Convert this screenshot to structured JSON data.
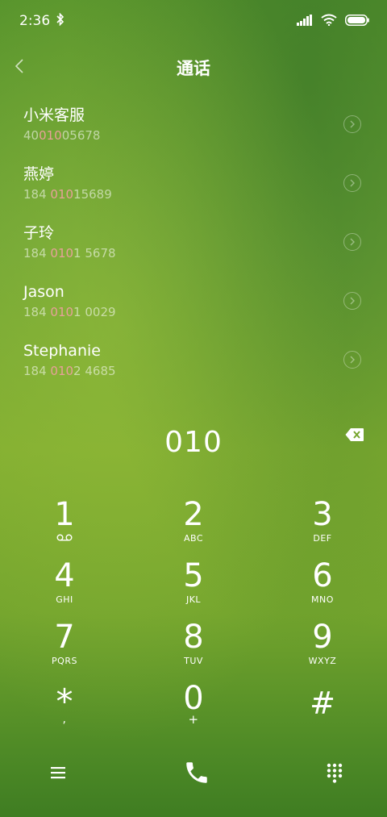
{
  "status": {
    "time": "2:36"
  },
  "header": {
    "title": "通话"
  },
  "contacts": [
    {
      "name": "小米客服",
      "number_pre": "40",
      "number_hl": "010",
      "number_post": "05678"
    },
    {
      "name": "燕婷",
      "number_pre": "184 ",
      "number_hl": "010",
      "number_post": "15689"
    },
    {
      "name": "子玲",
      "number_pre": "184 ",
      "number_hl": "010",
      "number_post": "1 5678"
    },
    {
      "name": "Jason",
      "number_pre": "184 ",
      "number_hl": "010",
      "number_post": "1 0029"
    },
    {
      "name": "Stephanie",
      "number_pre": "184 ",
      "number_hl": "010",
      "number_post": "2 4685"
    }
  ],
  "dialer": {
    "input": "010",
    "keys": [
      {
        "digit": "1",
        "letters": ""
      },
      {
        "digit": "2",
        "letters": "ABC"
      },
      {
        "digit": "3",
        "letters": "DEF"
      },
      {
        "digit": "4",
        "letters": "GHI"
      },
      {
        "digit": "5",
        "letters": "JKL"
      },
      {
        "digit": "6",
        "letters": "MNO"
      },
      {
        "digit": "7",
        "letters": "PQRS"
      },
      {
        "digit": "8",
        "letters": "TUV"
      },
      {
        "digit": "9",
        "letters": "WXYZ"
      },
      {
        "digit": "*",
        "letters": ","
      },
      {
        "digit": "0",
        "letters": "+"
      },
      {
        "digit": "#",
        "letters": ""
      }
    ]
  },
  "icons": {
    "bluetooth": "bluetooth-icon",
    "signal": "signal-icon",
    "wifi": "wifi-icon",
    "battery": "battery-icon",
    "back": "back-icon",
    "detail": "chevron-right-circle-icon",
    "delete": "backspace-icon",
    "voicemail": "voicemail-icon",
    "menu": "menu-icon",
    "call": "phone-icon",
    "keypad": "keypad-icon"
  },
  "colors": {
    "highlight": "#e7a199"
  }
}
